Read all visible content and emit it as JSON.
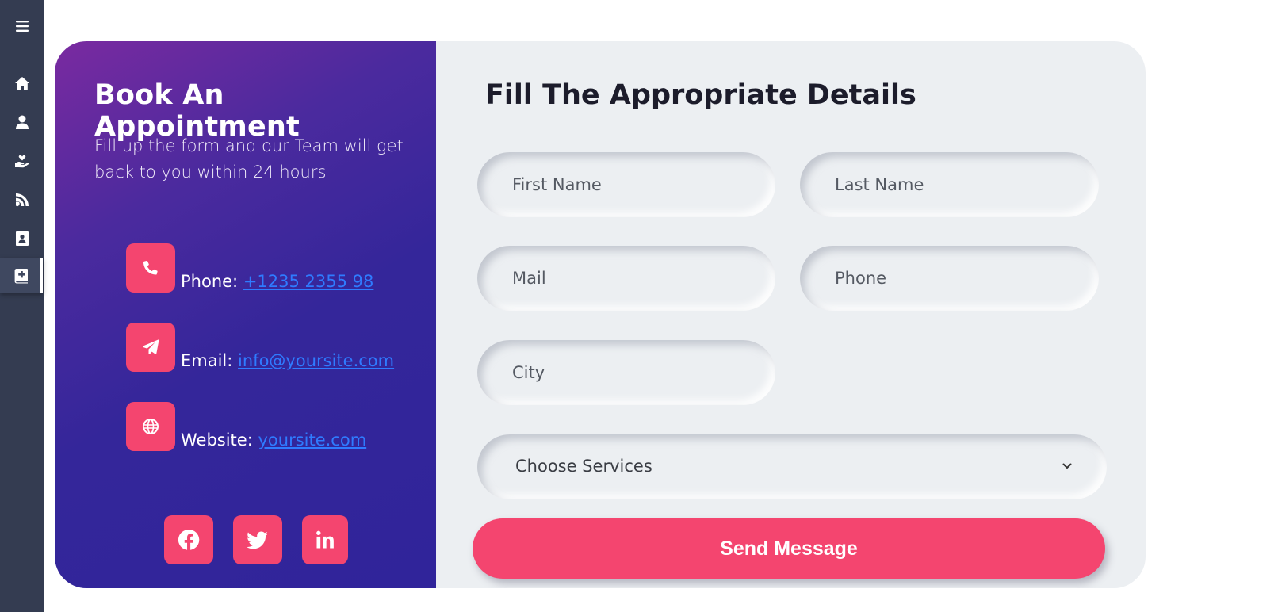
{
  "colors": {
    "sidebar": "#343c51",
    "accent": "#f4456f",
    "panel_purple": "#30249a",
    "link": "#2f7bff",
    "card_bg": "#eceff2"
  },
  "sidebar": {
    "items": [
      {
        "icon": "menu-icon"
      },
      {
        "icon": "home-icon"
      },
      {
        "icon": "user-icon"
      },
      {
        "icon": "hand-heart-icon"
      },
      {
        "icon": "blog-icon"
      },
      {
        "icon": "contact-book-icon"
      },
      {
        "icon": "medical-book-icon",
        "active": true
      }
    ]
  },
  "info_panel": {
    "title": "Book An Appointment",
    "subtitle": "Fill up the form and our Team will get back to you within 24 hours",
    "contacts": [
      {
        "icon": "phone-icon",
        "label": "Phone:",
        "value": "+1235 2355 98"
      },
      {
        "icon": "paper-plane-icon",
        "label": "Email:",
        "value": "info@yoursite.com"
      },
      {
        "icon": "globe-icon",
        "label": "Website:",
        "value": "yoursite.com"
      }
    ],
    "social": [
      "facebook-icon",
      "twitter-icon",
      "linkedin-icon"
    ]
  },
  "form": {
    "title": "Fill The Appropriate Details",
    "first_name_placeholder": "First Name",
    "last_name_placeholder": "Last Name",
    "mail_placeholder": "Mail",
    "phone_placeholder": "Phone",
    "city_placeholder": "City",
    "service_selected": "Choose Services",
    "submit_label": "Send Message"
  }
}
